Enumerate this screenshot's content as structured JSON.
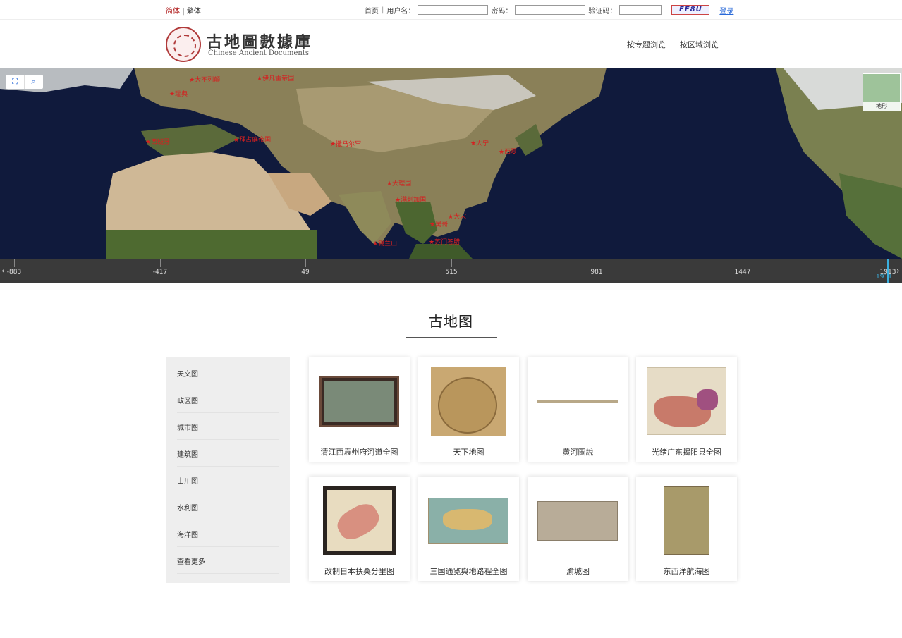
{
  "topbar": {
    "lang_simplified": "简体",
    "lang_divider": "|",
    "lang_traditional": "繁体",
    "home": "首页",
    "username_label": "用户名：",
    "password_label": "密码：",
    "captcha_label": "验证码：",
    "captcha_text": "FF8U",
    "login_label": "登录"
  },
  "header": {
    "logo_title": "古地圖數據庫",
    "logo_subtitle": "Chinese Ancient Documents",
    "nav": [
      "按专题浏览",
      "按区域浏览"
    ]
  },
  "map": {
    "layer_label": "地形",
    "markers": [
      "大不列颠",
      "瑞典",
      "伊凡雷帝国",
      "西班牙",
      "拜占庭帝国",
      "撒马尔罕",
      "大宁",
      "西夏",
      "大理国",
      "满刺加国",
      "大宋",
      "吴哥",
      "锡兰山",
      "苏门答腊"
    ]
  },
  "timeline": {
    "ticks": [
      "-883",
      "-417",
      "49",
      "515",
      "981",
      "1447",
      "1913"
    ],
    "current": "1911"
  },
  "section": {
    "title": "古地图"
  },
  "sidebar": {
    "items": [
      "天文图",
      "政区图",
      "城市图",
      "建筑图",
      "山川图",
      "水利图",
      "海洋图",
      "查看更多"
    ]
  },
  "maps": [
    {
      "title": "清江西袁州府河道全图"
    },
    {
      "title": "天下地图"
    },
    {
      "title": "黄河圖說"
    },
    {
      "title": "光绪广东揭阳县全图"
    },
    {
      "title": "改制日本扶桑分里图"
    },
    {
      "title": "三国通览舆地路程全图"
    },
    {
      "title": "渝城图"
    },
    {
      "title": "东西洋航海图"
    }
  ],
  "colors": {
    "accent_red": "#b01d1d",
    "link_blue": "#2a6ad8",
    "timeline_bg": "#3a3a3a",
    "timeline_cursor": "#3ab0e0",
    "sidebar_bg": "#eeeeee"
  }
}
